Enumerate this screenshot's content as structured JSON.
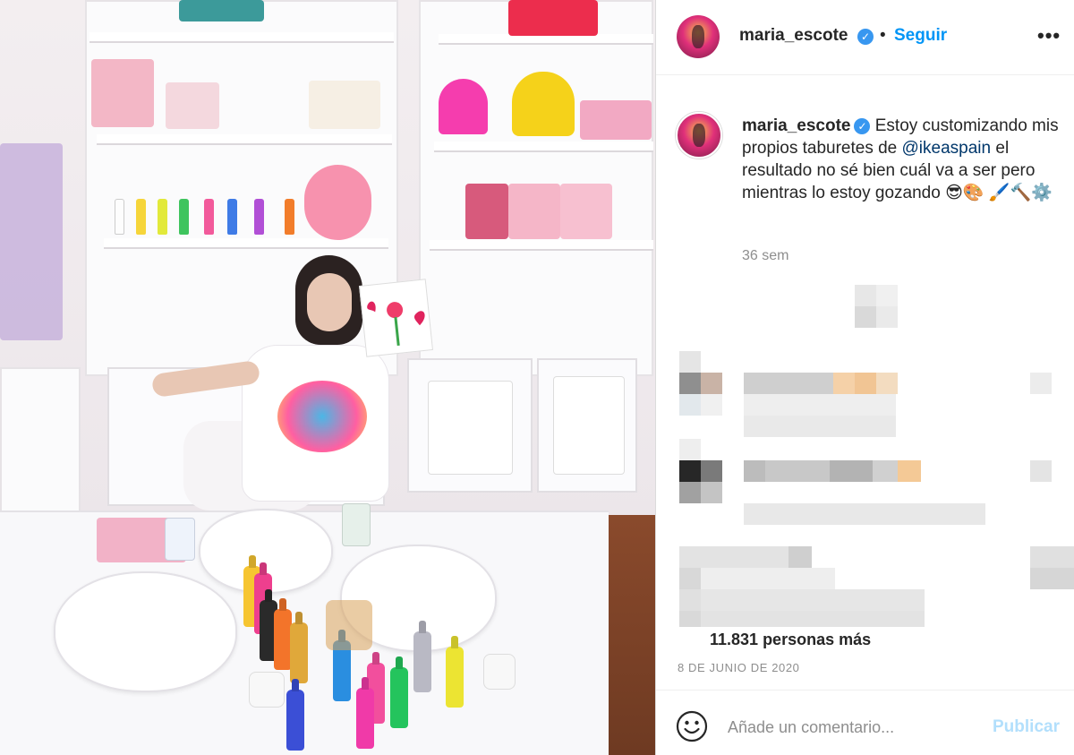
{
  "post": {
    "image_alt": "",
    "author": {
      "username": "maria_escote",
      "verified_icon": "verified-badge-icon",
      "separator": "•",
      "follow_label": "Seguir",
      "more_icon": "more-options-icon",
      "more_label": "•••"
    },
    "caption": {
      "username": "maria_escote",
      "text_before": " Estoy customizando mis propios taburetes de ",
      "mention": "@ikeaspain",
      "text_after": " el resultado no sé bien cuál va a ser pero mientras lo estoy gozando 😎🎨 🖌️🔨⚙️",
      "time_ago": "36 sem"
    },
    "likes": {
      "text": "11.831 personas más"
    },
    "date": "8 DE JUNIO DE 2020",
    "comment_box": {
      "emoji_icon": "emoji-icon",
      "placeholder": "Añade un comentario...",
      "publish_label": "Publicar"
    },
    "colors": {
      "link_blue": "#0095f6",
      "publish_disabled": "#b2dffc",
      "mention": "#00376b",
      "verified": "#3897f0"
    }
  }
}
